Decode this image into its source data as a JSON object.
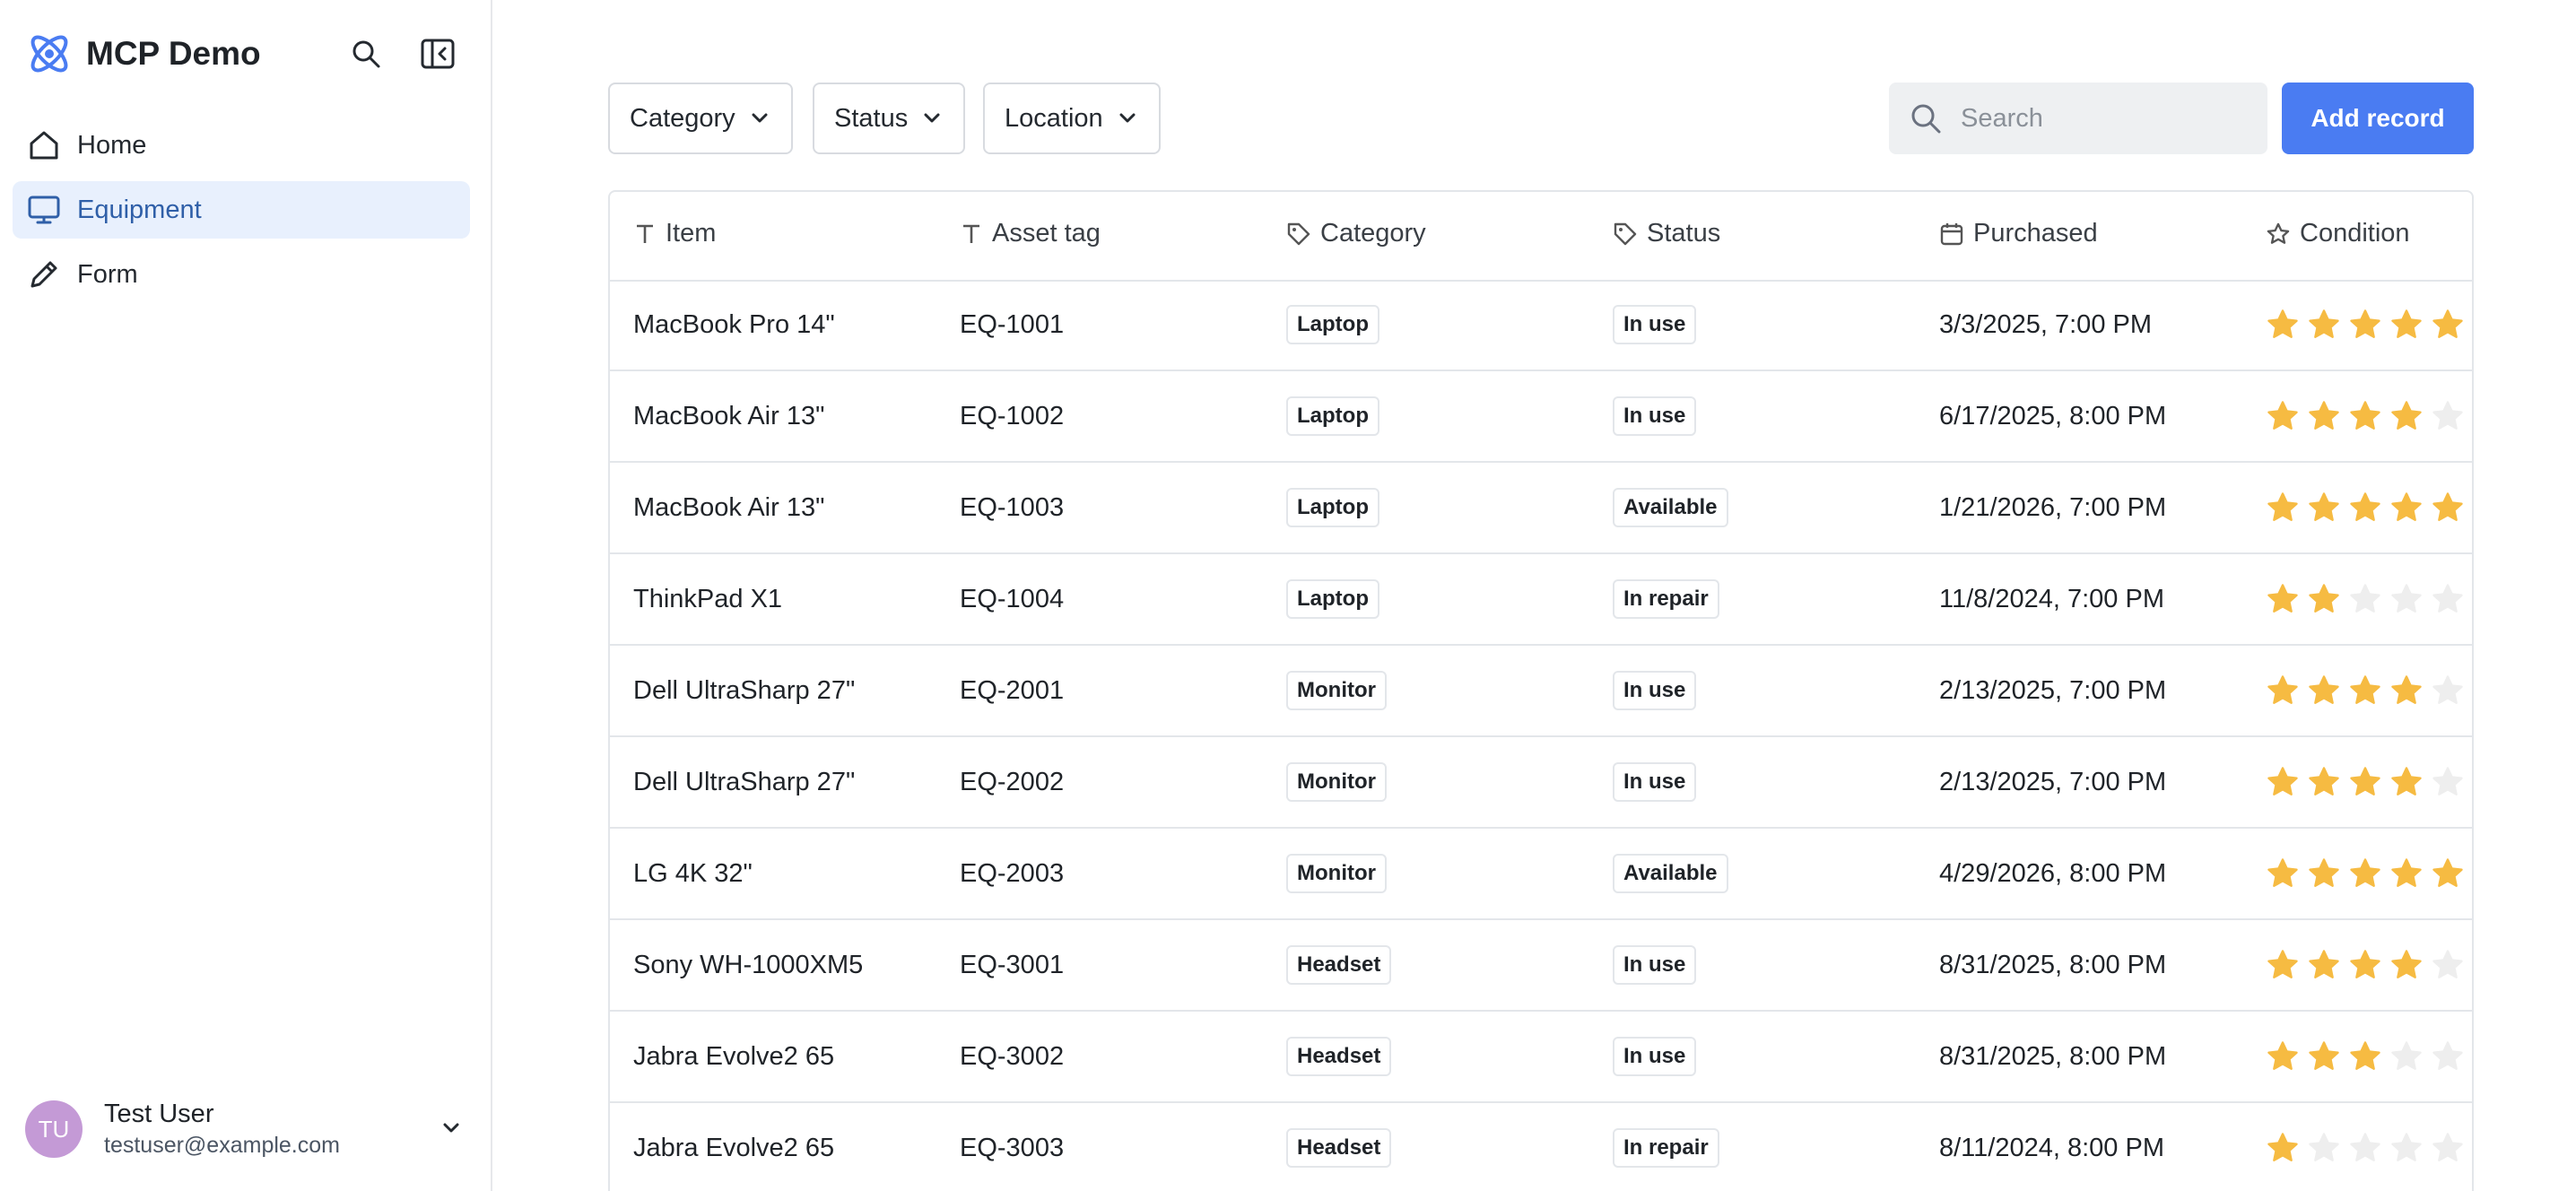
{
  "app": {
    "title": "MCP Demo"
  },
  "sidebar": {
    "items": [
      {
        "label": "Home",
        "icon": "home-icon",
        "active": false
      },
      {
        "label": "Equipment",
        "icon": "monitor-icon",
        "active": true
      },
      {
        "label": "Form",
        "icon": "pen-icon",
        "active": false
      }
    ]
  },
  "user": {
    "initials": "TU",
    "name": "Test User",
    "email": "testuser@example.com"
  },
  "toolbar": {
    "filters": [
      "Category",
      "Status",
      "Location"
    ],
    "search_placeholder": "Search",
    "add_label": "Add record"
  },
  "colors": {
    "accent": "#4a7cf2",
    "active_bg": "#e8f0fd",
    "star_on": "#f6bb42",
    "star_off": "#eeeeee"
  },
  "table": {
    "columns": [
      "Item",
      "Asset tag",
      "Category",
      "Status",
      "Purchased",
      "Condition"
    ],
    "rows": [
      {
        "item": "MacBook Pro 14\"",
        "tag": "EQ-1001",
        "category": "Laptop",
        "status": "In use",
        "purchased": "3/3/2025, 7:00 PM",
        "condition": 5
      },
      {
        "item": "MacBook Air 13\"",
        "tag": "EQ-1002",
        "category": "Laptop",
        "status": "In use",
        "purchased": "6/17/2025, 8:00 PM",
        "condition": 4
      },
      {
        "item": "MacBook Air 13\"",
        "tag": "EQ-1003",
        "category": "Laptop",
        "status": "Available",
        "purchased": "1/21/2026, 7:00 PM",
        "condition": 5
      },
      {
        "item": "ThinkPad X1",
        "tag": "EQ-1004",
        "category": "Laptop",
        "status": "In repair",
        "purchased": "11/8/2024, 7:00 PM",
        "condition": 2
      },
      {
        "item": "Dell UltraSharp 27\"",
        "tag": "EQ-2001",
        "category": "Monitor",
        "status": "In use",
        "purchased": "2/13/2025, 7:00 PM",
        "condition": 4
      },
      {
        "item": "Dell UltraSharp 27\"",
        "tag": "EQ-2002",
        "category": "Monitor",
        "status": "In use",
        "purchased": "2/13/2025, 7:00 PM",
        "condition": 4
      },
      {
        "item": "LG 4K 32\"",
        "tag": "EQ-2003",
        "category": "Monitor",
        "status": "Available",
        "purchased": "4/29/2026, 8:00 PM",
        "condition": 5
      },
      {
        "item": "Sony WH-1000XM5",
        "tag": "EQ-3001",
        "category": "Headset",
        "status": "In use",
        "purchased": "8/31/2025, 8:00 PM",
        "condition": 4
      },
      {
        "item": "Jabra Evolve2 65",
        "tag": "EQ-3002",
        "category": "Headset",
        "status": "In use",
        "purchased": "8/31/2025, 8:00 PM",
        "condition": 3
      },
      {
        "item": "Jabra Evolve2 65",
        "tag": "EQ-3003",
        "category": "Headset",
        "status": "In repair",
        "purchased": "8/11/2024, 8:00 PM",
        "condition": 1
      }
    ]
  }
}
